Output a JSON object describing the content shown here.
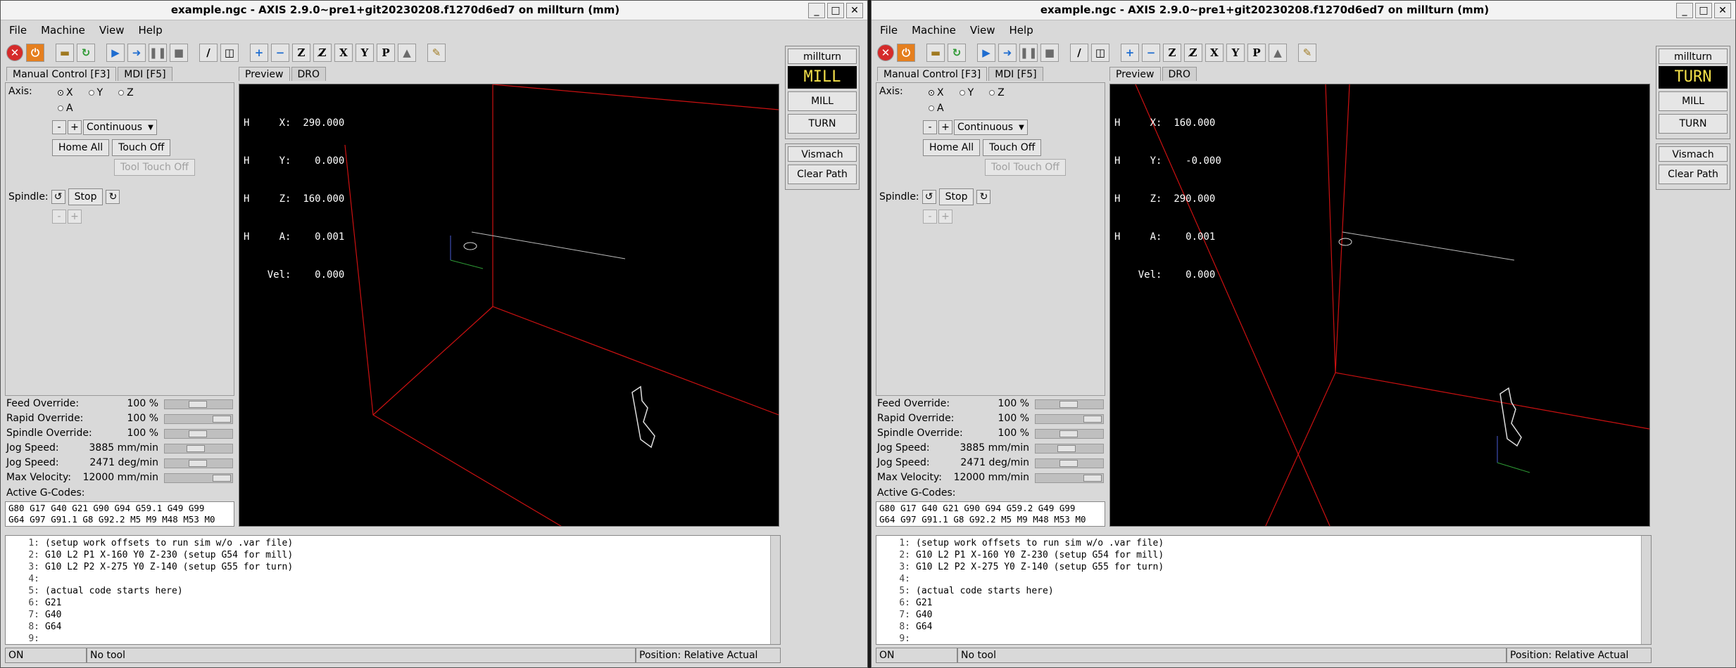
{
  "windows": [
    {
      "title": "example.ngc - AXIS 2.9.0~pre1+git20230208.f1270d6ed7 on millturn (mm)",
      "window_controls": [
        "_",
        "□",
        "✕"
      ],
      "menus": [
        "File",
        "Machine",
        "View",
        "Help"
      ],
      "tabs_left": [
        "Manual Control [F3]",
        "MDI [F5]"
      ],
      "tabs_right": [
        "Preview",
        "DRO"
      ],
      "axis_label": "Axis:",
      "axes": [
        "X",
        "Y",
        "Z",
        "A"
      ],
      "selected_axis": "X",
      "jog_minus": "-",
      "jog_plus": "+",
      "jog_mode": "Continuous",
      "home_all": "Home All",
      "touch_off": "Touch Off",
      "tool_touch_off": "Tool Touch Off",
      "spindle_label": "Spindle:",
      "spindle_stop": "Stop",
      "overrides": [
        {
          "label": "Feed Override:",
          "value": "100 %",
          "level": 0.5
        },
        {
          "label": "Rapid Override:",
          "value": "100 %",
          "level": 1.0
        },
        {
          "label": "Spindle Override:",
          "value": "100 %",
          "level": 0.5
        },
        {
          "label": "Jog Speed:",
          "value": "3885 mm/min",
          "level": 0.45
        },
        {
          "label": "Jog Speed:",
          "value": "2471 deg/min",
          "level": 0.5
        },
        {
          "label": "Max Velocity:",
          "value": "12000 mm/min",
          "level": 1.0
        }
      ],
      "gcodes_label": "Active G-Codes:",
      "gcodes": [
        "G80 G17 G40 G21 G90 G94 G59.1 G49 G99",
        "G64 G97 G91.1 G8 G92.2 M5 M9 M48 M53 M0"
      ],
      "dro": [
        {
          "h": "H",
          "axis": "X:",
          "val": "290.000"
        },
        {
          "h": "H",
          "axis": "Y:",
          "val": "0.000"
        },
        {
          "h": "H",
          "axis": "Z:",
          "val": "160.000"
        },
        {
          "h": "H",
          "axis": "A:",
          "val": "0.001"
        },
        {
          "h": "",
          "axis": "Vel:",
          "val": "0.000"
        }
      ],
      "machine_name": "millturn",
      "mode": "MILL",
      "mill_button": "MILL",
      "turn_button": "TURN",
      "vismach_button": "Vismach",
      "clear_path_button": "Clear Path",
      "code_lines": [
        {
          "n": "1:",
          "t": "(setup work offsets to run sim w/o .var file)"
        },
        {
          "n": "2:",
          "t": "G10 L2 P1 X-160 Y0 Z-230 (setup G54 for mill)"
        },
        {
          "n": "3:",
          "t": "G10 L2 P2 X-275 Y0 Z-140 (setup G55 for turn)"
        },
        {
          "n": "4:",
          "t": ""
        },
        {
          "n": "5:",
          "t": "(actual code starts here)"
        },
        {
          "n": "6:",
          "t": "G21"
        },
        {
          "n": "7:",
          "t": "G40"
        },
        {
          "n": "8:",
          "t": "G64"
        },
        {
          "n": "9:",
          "t": ""
        }
      ],
      "status": {
        "state": "ON",
        "tool": "No tool",
        "position": "Position: Relative Actual"
      }
    },
    {
      "title": "example.ngc - AXIS 2.9.0~pre1+git20230208.f1270d6ed7 on millturn (mm)",
      "window_controls": [
        "_",
        "□",
        "✕"
      ],
      "menus": [
        "File",
        "Machine",
        "View",
        "Help"
      ],
      "tabs_left": [
        "Manual Control [F3]",
        "MDI [F5]"
      ],
      "tabs_right": [
        "Preview",
        "DRO"
      ],
      "axis_label": "Axis:",
      "axes": [
        "X",
        "Y",
        "Z",
        "A"
      ],
      "selected_axis": "X",
      "jog_minus": "-",
      "jog_plus": "+",
      "jog_mode": "Continuous",
      "home_all": "Home All",
      "touch_off": "Touch Off",
      "tool_touch_off": "Tool Touch Off",
      "spindle_label": "Spindle:",
      "spindle_stop": "Stop",
      "overrides": [
        {
          "label": "Feed Override:",
          "value": "100 %",
          "level": 0.5
        },
        {
          "label": "Rapid Override:",
          "value": "100 %",
          "level": 1.0
        },
        {
          "label": "Spindle Override:",
          "value": "100 %",
          "level": 0.5
        },
        {
          "label": "Jog Speed:",
          "value": "3885 mm/min",
          "level": 0.45
        },
        {
          "label": "Jog Speed:",
          "value": "2471 deg/min",
          "level": 0.5
        },
        {
          "label": "Max Velocity:",
          "value": "12000 mm/min",
          "level": 1.0
        }
      ],
      "gcodes_label": "Active G-Codes:",
      "gcodes": [
        "G80 G17 G40 G21 G90 G94 G59.2 G49 G99",
        "G64 G97 G91.1 G8 G92.2 M5 M9 M48 M53 M0"
      ],
      "dro": [
        {
          "h": "H",
          "axis": "X:",
          "val": "160.000"
        },
        {
          "h": "H",
          "axis": "Y:",
          "val": "-0.000"
        },
        {
          "h": "H",
          "axis": "Z:",
          "val": "290.000"
        },
        {
          "h": "H",
          "axis": "A:",
          "val": "0.001"
        },
        {
          "h": "",
          "axis": "Vel:",
          "val": "0.000"
        }
      ],
      "machine_name": "millturn",
      "mode": "TURN",
      "mill_button": "MILL",
      "turn_button": "TURN",
      "vismach_button": "Vismach",
      "clear_path_button": "Clear Path",
      "code_lines": [
        {
          "n": "1:",
          "t": "(setup work offsets to run sim w/o .var file)"
        },
        {
          "n": "2:",
          "t": "G10 L2 P1 X-160 Y0 Z-230 (setup G54 for mill)"
        },
        {
          "n": "3:",
          "t": "G10 L2 P2 X-275 Y0 Z-140 (setup G55 for turn)"
        },
        {
          "n": "4:",
          "t": ""
        },
        {
          "n": "5:",
          "t": "(actual code starts here)"
        },
        {
          "n": "6:",
          "t": "G21"
        },
        {
          "n": "7:",
          "t": "G40"
        },
        {
          "n": "8:",
          "t": "G64"
        },
        {
          "n": "9:",
          "t": ""
        }
      ],
      "status": {
        "state": "ON",
        "tool": "No tool",
        "position": "Position: Relative Actual"
      }
    }
  ],
  "toolbar_icons": [
    "estop-icon",
    "power-icon",
    "open-file-icon",
    "reload-icon",
    "run-icon",
    "step-icon",
    "pause-icon",
    "stop-icon",
    "block-delete-icon",
    "optional-stop-icon",
    "zoom-in-icon",
    "zoom-out-icon",
    "view-z-icon",
    "view-z2-icon",
    "view-x-icon",
    "view-y-icon",
    "view-p-icon",
    "rotate-icon",
    "clear-live-plot-icon"
  ],
  "colors": {
    "window_bg": "#d9d9d9",
    "preview_bg": "#000000",
    "mode_text": "#f3e04a",
    "machine_limits": "#cc1111"
  }
}
